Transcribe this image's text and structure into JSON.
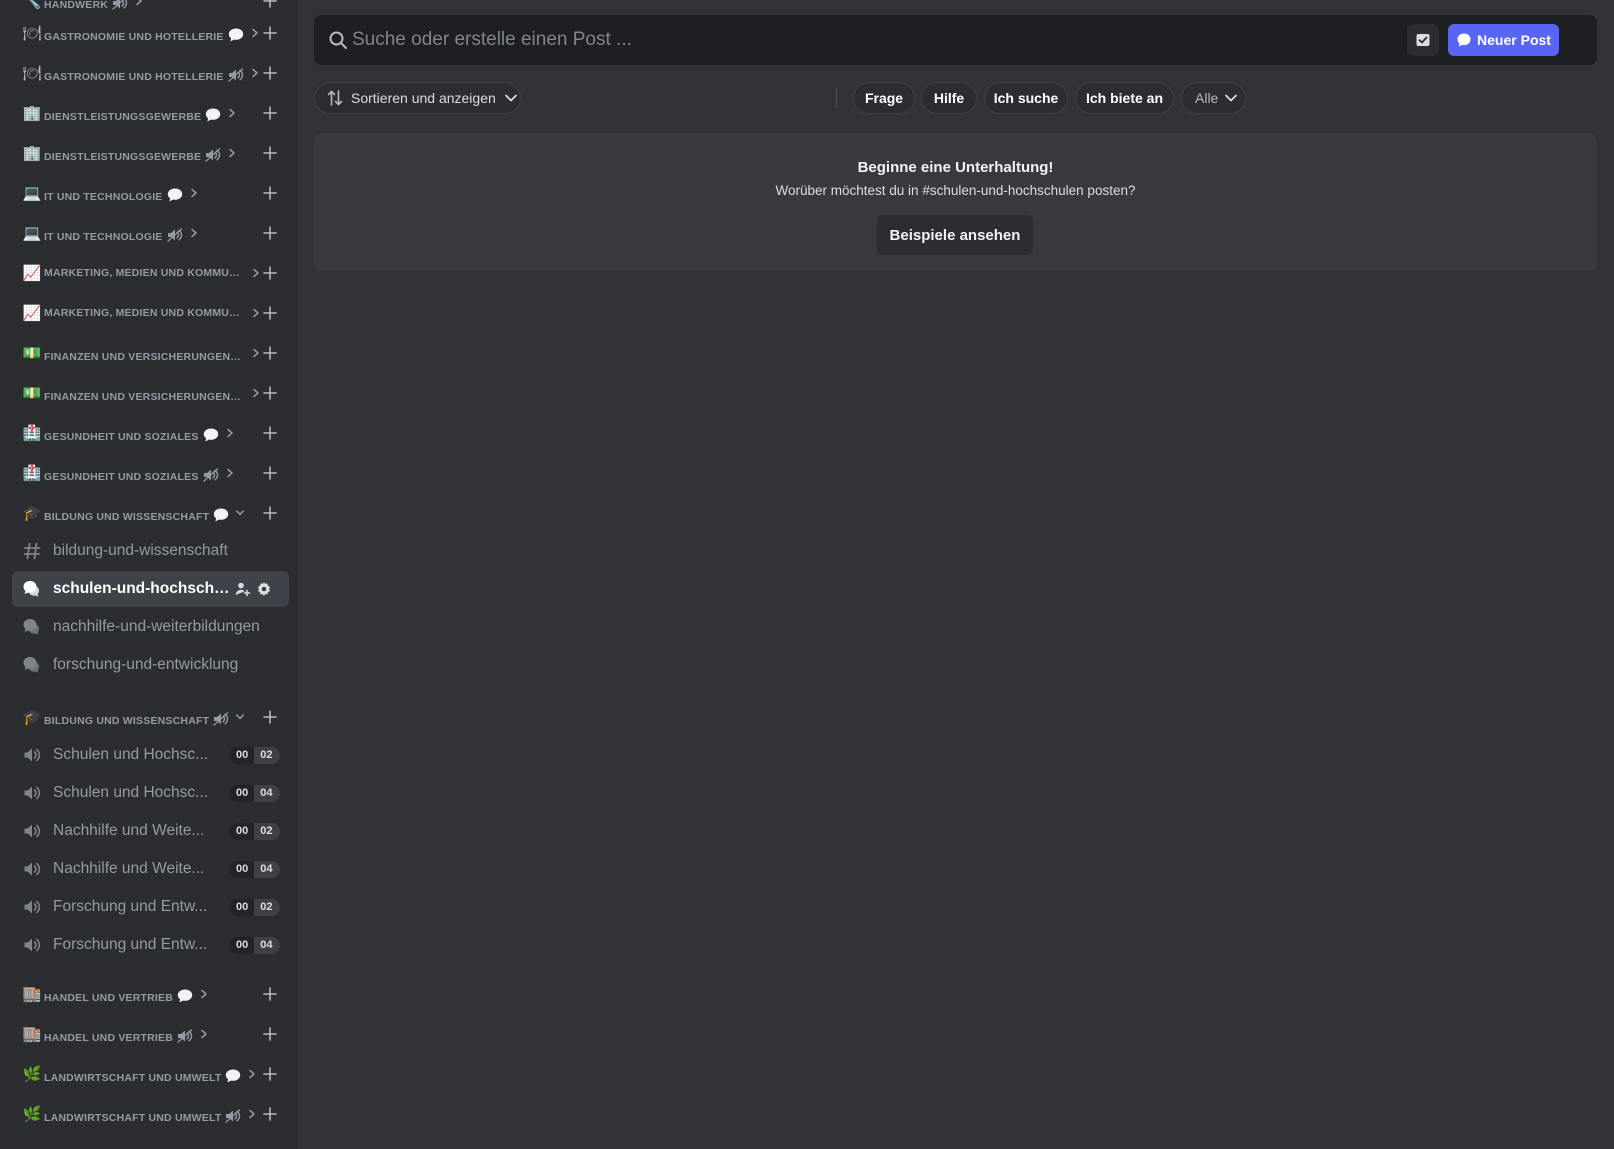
{
  "sidebar": {
    "top_partial": {
      "icon": "wrench-icon",
      "emoji": "🔧",
      "label": "Handwerk",
      "badge": "voice"
    },
    "categories_top": [
      {
        "emoji": "🍽",
        "label": "Gastronomie und Hotellerie",
        "badge": "chat"
      },
      {
        "emoji": "🍽",
        "label": "Gastronomie und Hotellerie",
        "badge": "voice"
      },
      {
        "emoji": "🏢",
        "label": "Dienstleistungsgewerbe",
        "badge": "chat"
      },
      {
        "emoji": "🏢",
        "label": "Dienstleistungsgewerbe",
        "badge": "voice"
      },
      {
        "emoji": "💻",
        "label": "IT und Technologie",
        "badge": "chat"
      },
      {
        "emoji": "💻",
        "label": "IT und Technologie",
        "badge": "voice"
      },
      {
        "emoji": "📈",
        "label": "Marketing, Medien und Kommuni...",
        "badge": "none"
      },
      {
        "emoji": "📈",
        "label": "Marketing, Medien und Kommuni...",
        "badge": "none"
      },
      {
        "emoji": "💵",
        "label": "Finanzen und Versicherungen",
        "badge": "chat"
      },
      {
        "emoji": "💵",
        "label": "Finanzen und Versicherungen",
        "badge": "voice"
      },
      {
        "emoji": "🏥",
        "label": "Gesundheit und Soziales",
        "badge": "chat"
      },
      {
        "emoji": "🏥",
        "label": "Gesundheit und Soziales",
        "badge": "voice"
      }
    ],
    "bildung_chat": {
      "emoji": "🎓",
      "label": "Bildung und Wissenschaft",
      "badge": "chat",
      "channels": [
        {
          "type": "text",
          "name": "bildung-und-wissenschaft"
        },
        {
          "type": "forum",
          "name": "schulen-und-hochschul...",
          "active": true
        },
        {
          "type": "forum",
          "name": "nachhilfe-und-weiterbildungen"
        },
        {
          "type": "forum",
          "name": "forschung-und-entwicklung"
        }
      ]
    },
    "bildung_voice": {
      "emoji": "🎓",
      "label": "Bildung und Wissenschaft",
      "badge": "voice",
      "channels": [
        {
          "name": "Schulen und Hochsc...",
          "count_a": "00",
          "count_b": "02"
        },
        {
          "name": "Schulen und Hochsc...",
          "count_a": "00",
          "count_b": "04"
        },
        {
          "name": "Nachhilfe und Weite...",
          "count_a": "00",
          "count_b": "02"
        },
        {
          "name": "Nachhilfe und Weite...",
          "count_a": "00",
          "count_b": "04"
        },
        {
          "name": "Forschung und Entw...",
          "count_a": "00",
          "count_b": "02"
        },
        {
          "name": "Forschung und Entw...",
          "count_a": "00",
          "count_b": "04"
        }
      ]
    },
    "categories_bottom": [
      {
        "emoji": "🏬",
        "label": "Handel und Vertrieb",
        "badge": "chat"
      },
      {
        "emoji": "🏬",
        "label": "Handel und Vertrieb",
        "badge": "voice"
      },
      {
        "emoji": "🌿",
        "label": "Landwirtschaft und Umwelt",
        "badge": "chat"
      },
      {
        "emoji": "🌿",
        "label": "Landwirtschaft und Umwelt",
        "badge": "voice"
      }
    ]
  },
  "main": {
    "search": {
      "placeholder": "Suche oder erstelle einen Post ...",
      "value": ""
    },
    "new_post_label": "Neuer Post",
    "sort_label": "Sortieren und anzeigen",
    "tags": [
      "Frage",
      "Hilfe",
      "Ich suche",
      "Ich biete an"
    ],
    "tag_all_label": "Alle",
    "empty_state": {
      "title": "Beginne eine Unterhaltung!",
      "subtitle": "Worüber möchtest du in #schulen-und-hochschulen posten?",
      "button": "Beispiele ansehen"
    }
  },
  "colors": {
    "sidebar_bg": "#2b2d31",
    "main_bg": "#313338",
    "accent": "#5865f2",
    "active_channel_bg": "#404249"
  }
}
